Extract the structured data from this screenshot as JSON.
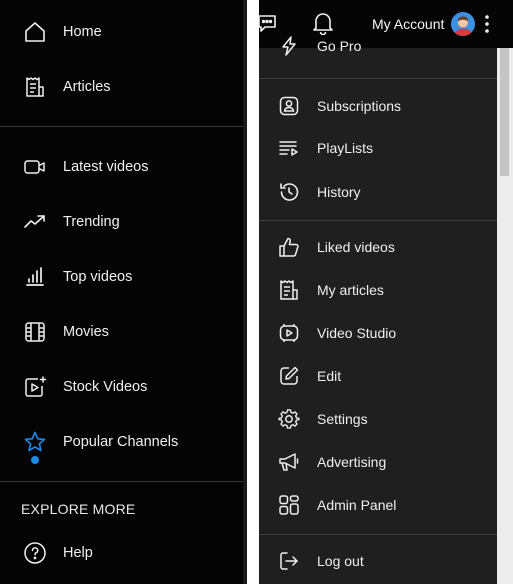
{
  "sidebar": {
    "items": [
      {
        "label": "Home",
        "icon": "home-icon"
      },
      {
        "label": "Articles",
        "icon": "receipt-icon"
      },
      {
        "label": "Latest videos",
        "icon": "video-camera-icon"
      },
      {
        "label": "Trending",
        "icon": "trending-up-icon"
      },
      {
        "label": "Top videos",
        "icon": "bar-chart-icon"
      },
      {
        "label": "Movies",
        "icon": "film-icon"
      },
      {
        "label": "Stock Videos",
        "icon": "video-add-icon"
      },
      {
        "label": "Popular Channels",
        "icon": "star-icon"
      }
    ],
    "explore_more": "EXPLORE MORE",
    "help": {
      "label": "Help",
      "icon": "question-circle-icon"
    }
  },
  "header": {
    "account_label": "My Account"
  },
  "account_menu": {
    "items": [
      {
        "label": "Go Pro",
        "icon": "lightning-icon"
      },
      {
        "label": "Subscriptions",
        "icon": "person-square-icon"
      },
      {
        "label": "PlayLists",
        "icon": "playlist-icon"
      },
      {
        "label": "History",
        "icon": "history-icon"
      },
      {
        "label": "Liked videos",
        "icon": "thumbs-up-icon"
      },
      {
        "label": "My articles",
        "icon": "receipt-icon"
      },
      {
        "label": "Video Studio",
        "icon": "video-studio-icon"
      },
      {
        "label": "Edit",
        "icon": "edit-icon"
      },
      {
        "label": "Settings",
        "icon": "gear-icon"
      },
      {
        "label": "Advertising",
        "icon": "megaphone-icon"
      },
      {
        "label": "Admin Panel",
        "icon": "dashboard-icon"
      },
      {
        "label": "Log out",
        "icon": "logout-icon"
      }
    ]
  },
  "colors": {
    "sidebar_bg": "#040404",
    "menu_bg": "#1f1f1f",
    "accent": "#1e88e5"
  }
}
